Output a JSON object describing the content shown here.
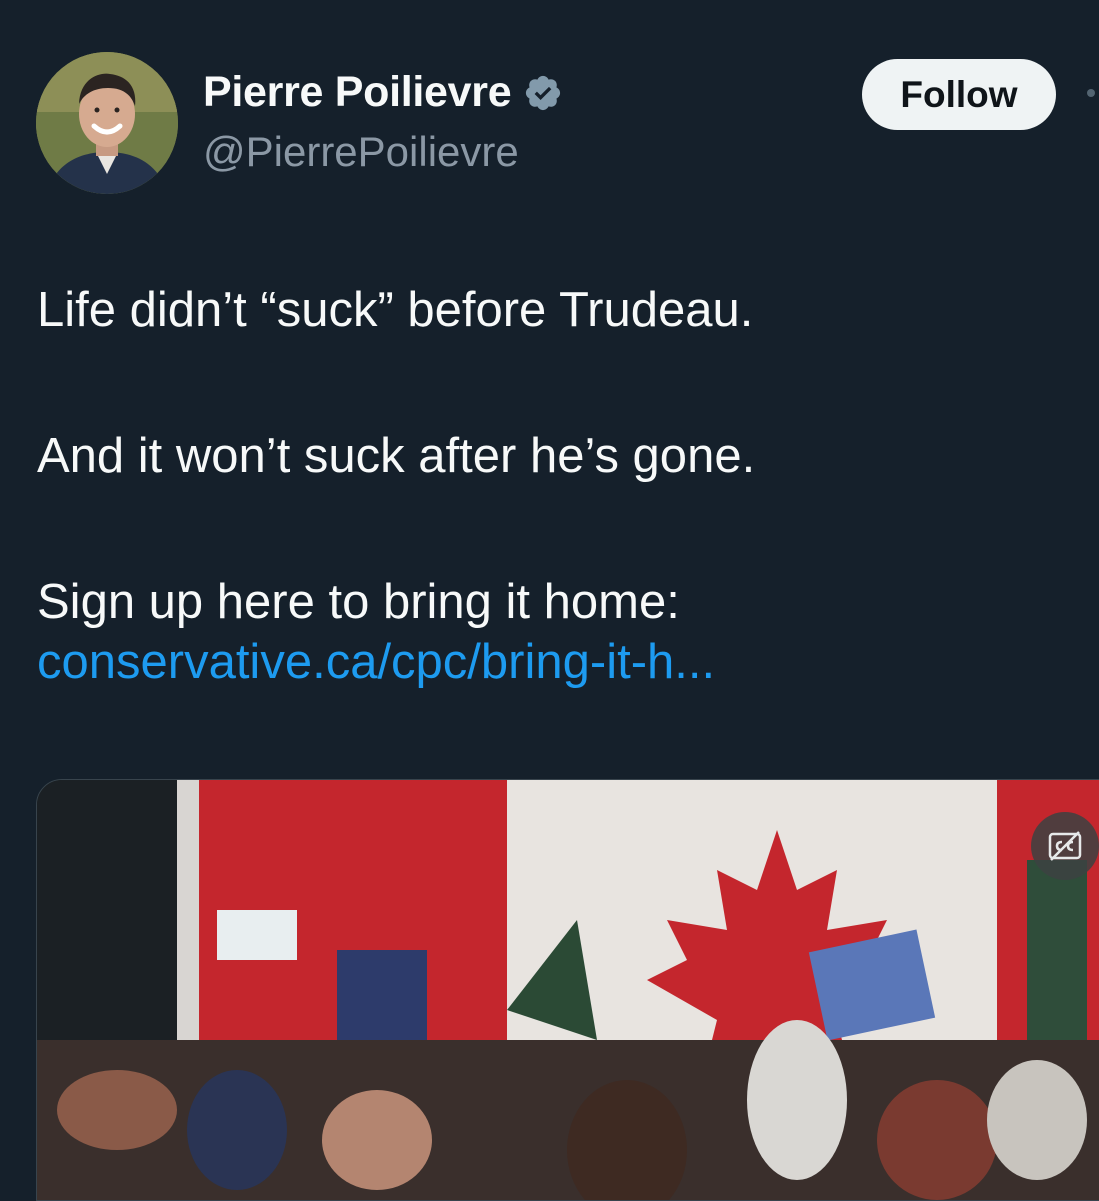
{
  "author": {
    "display_name": "Pierre Poilievre",
    "handle": "@PierrePoilievre",
    "verified": true,
    "avatar_icon": "profile-photo"
  },
  "actions": {
    "follow_label": "Follow"
  },
  "tweet": {
    "paragraphs": [
      "Life didn’t “suck” before Trudeau.",
      "And it won’t suck after he’s gone.",
      "Sign up here to bring it home:"
    ],
    "link_text": "conservative.ca/cpc/bring-it-h..."
  },
  "media": {
    "icon": "closed-captions-off-icon"
  },
  "colors": {
    "background": "#15202b",
    "link": "#1d9bf0",
    "muted_text": "#8b98a5",
    "verified_badge": "#829aab"
  }
}
